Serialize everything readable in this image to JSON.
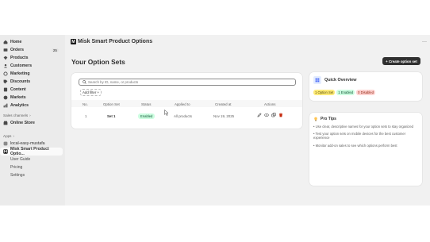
{
  "sidebar": {
    "items": [
      {
        "label": "Home",
        "icon": "home-icon"
      },
      {
        "label": "Orders",
        "icon": "orders-icon",
        "count": "25"
      },
      {
        "label": "Products",
        "icon": "products-icon"
      },
      {
        "label": "Customers",
        "icon": "customers-icon"
      },
      {
        "label": "Marketing",
        "icon": "marketing-icon"
      },
      {
        "label": "Discounts",
        "icon": "discounts-icon"
      },
      {
        "label": "Content",
        "icon": "content-icon"
      },
      {
        "label": "Markets",
        "icon": "markets-icon"
      },
      {
        "label": "Analytics",
        "icon": "analytics-icon"
      }
    ],
    "sales_channels_label": "Sales channels",
    "online_store": "Online Store",
    "apps_label": "Apps",
    "app_local": "local-easy-mustafa",
    "app_active": "Misk Smart Product Optio...",
    "app_subitems": [
      "User Guide",
      "Pricing",
      "Settings"
    ]
  },
  "header": {
    "app_title": "Misk Smart Product Options",
    "more": "···"
  },
  "page": {
    "title": "Your Option Sets",
    "create_button": "+ Create option set"
  },
  "table": {
    "search_placeholder": "Search by ID, name, or products",
    "add_filter": "Add filter +",
    "columns": [
      "No.",
      "Option Set",
      "Status",
      "Applied to",
      "Created at",
      "Actions"
    ],
    "rows": [
      {
        "no": "1",
        "name": "Set 1",
        "status": "Enabled",
        "applied_to": "All products",
        "created_at": "Nov 19, 2025"
      }
    ]
  },
  "quick_overview": {
    "title": "Quick Overview",
    "pills": [
      "1 Option Set",
      "1 Enabled",
      "0 Disabled"
    ]
  },
  "tips": {
    "title": "Pro Tips",
    "items": [
      "• Use clear, descriptive names for your option sets to stay organized",
      "• Test your option sets on mobile devices for the best customer experience",
      "• Monitor add-on sales to see which options perform best"
    ]
  },
  "colors": {
    "enabled_badge": "#cdfee1",
    "pill_yellow": "#ffeb78",
    "pill_green": "#cdfee1",
    "pill_red": "#fed3d1",
    "primary_button": "#303030"
  }
}
